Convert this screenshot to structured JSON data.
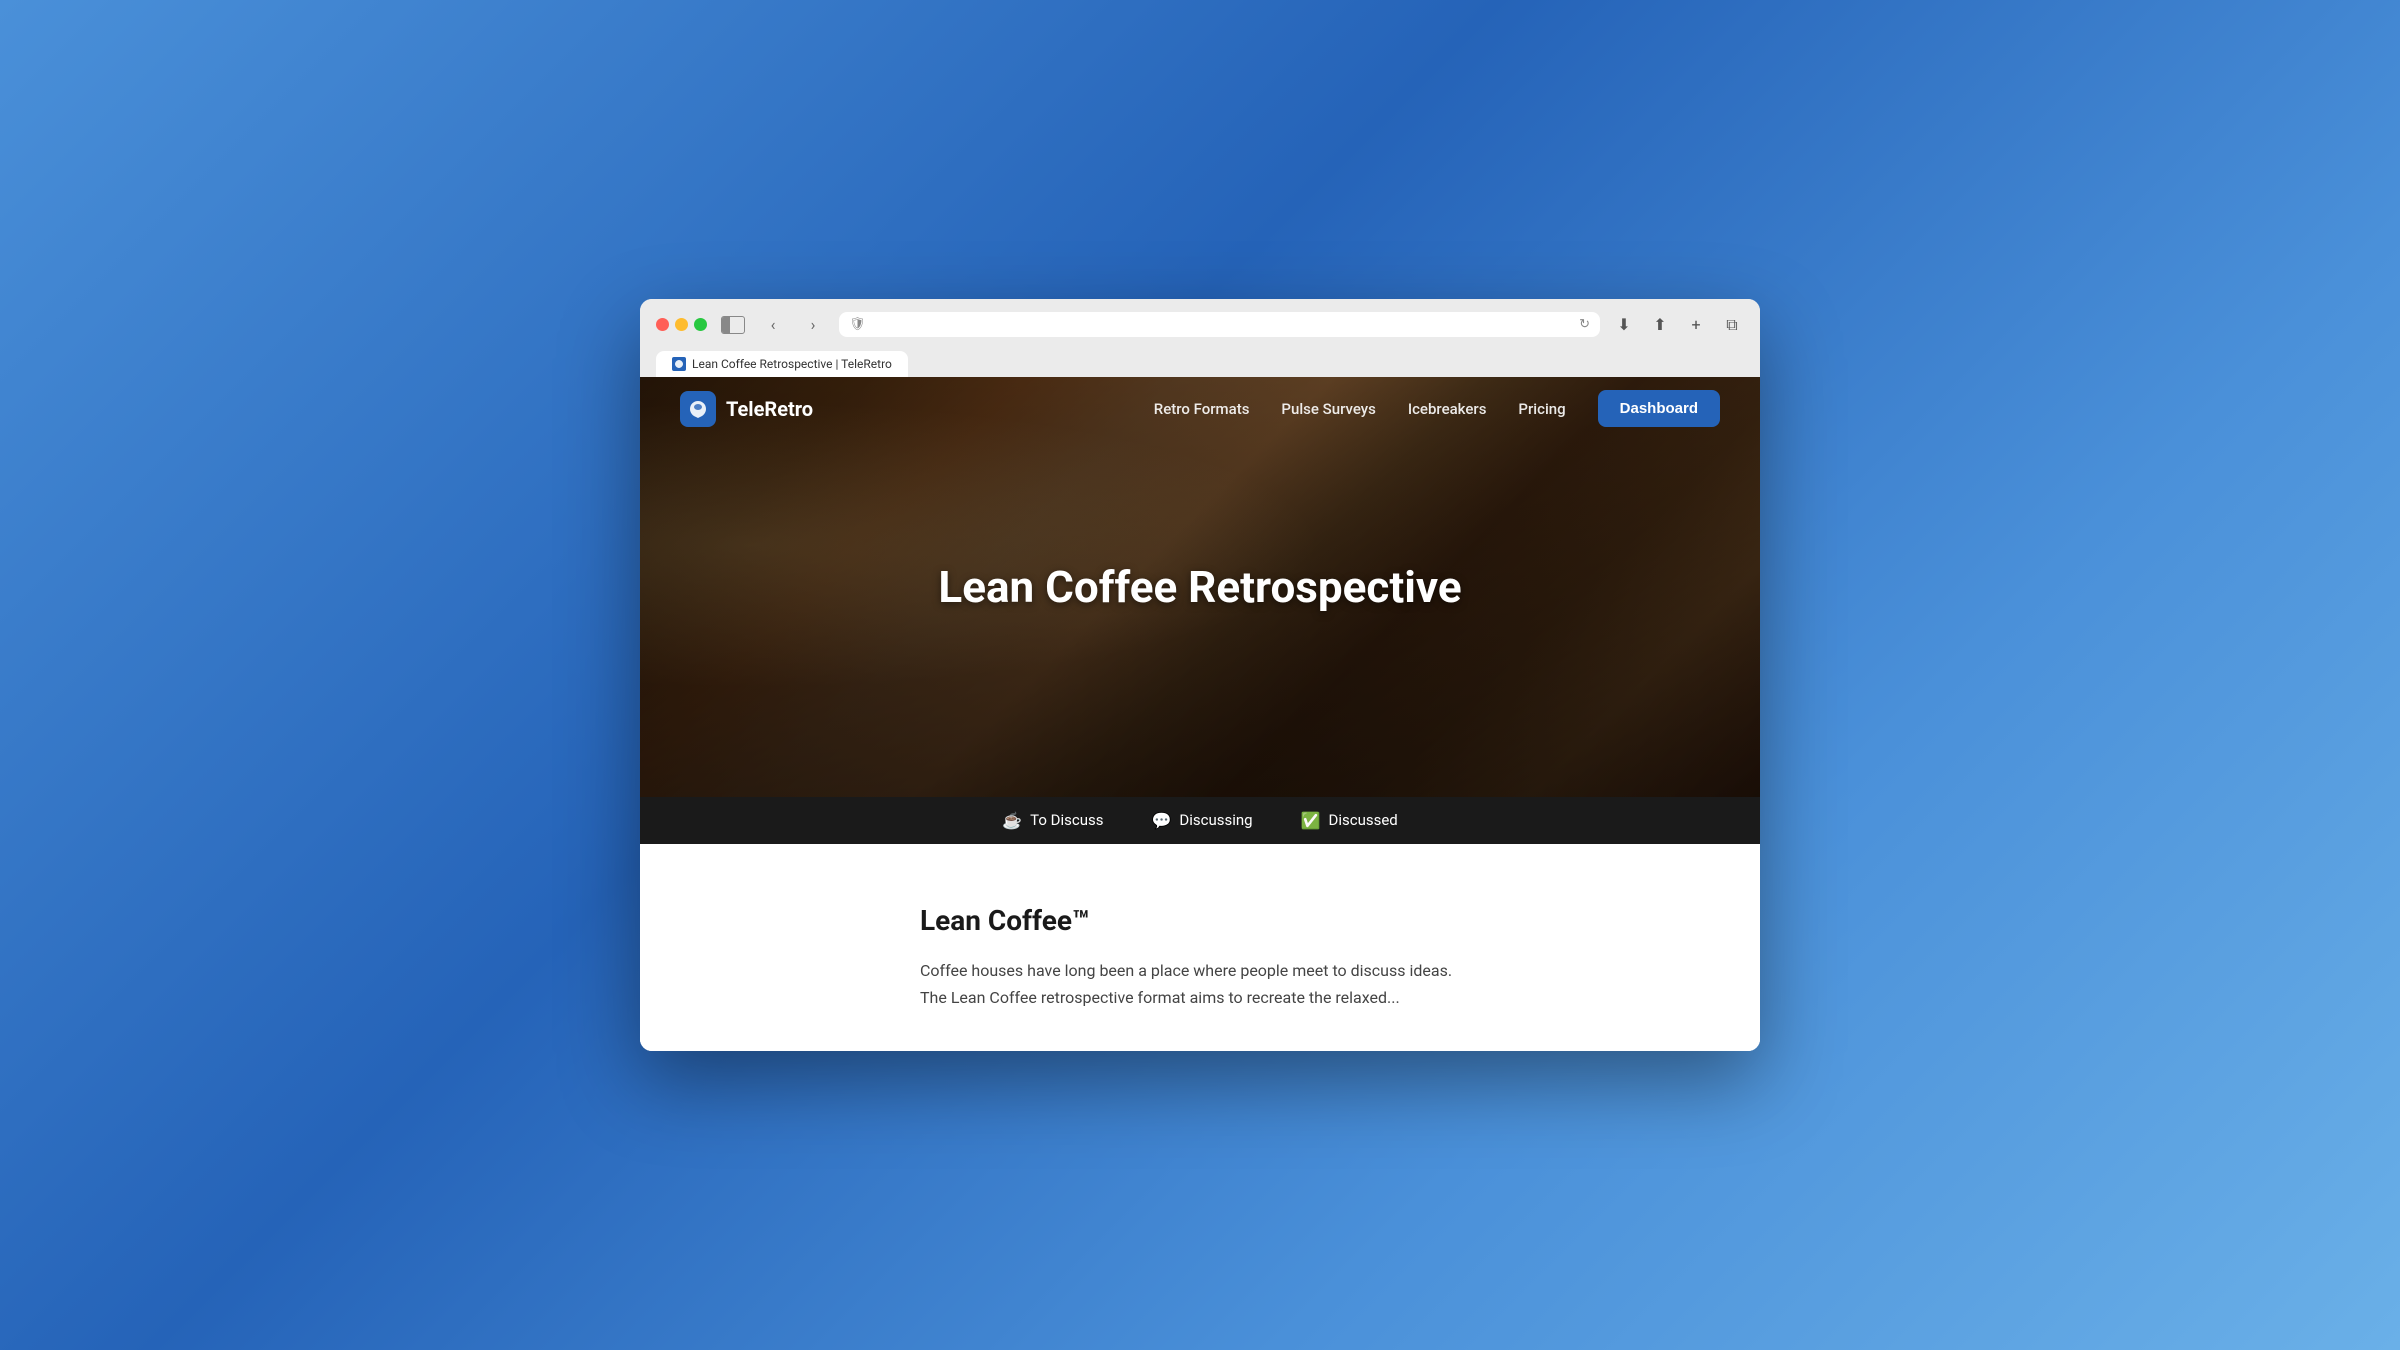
{
  "browser": {
    "address_bar_placeholder": "",
    "tab_label": "Lean Coffee Retrospective | TeleRetro"
  },
  "nav": {
    "logo_text": "TeleRetro",
    "links": [
      {
        "label": "Retro Formats",
        "id": "retro-formats"
      },
      {
        "label": "Pulse Surveys",
        "id": "pulse-surveys"
      },
      {
        "label": "Icebreakers",
        "id": "icebreakers"
      },
      {
        "label": "Pricing",
        "id": "pricing"
      }
    ],
    "dashboard_button": "Dashboard"
  },
  "hero": {
    "title": "Lean Coffee Retrospective"
  },
  "status_bar": {
    "items": [
      {
        "icon": "☕",
        "label": "To Discuss"
      },
      {
        "icon": "💬",
        "label": "Discussing"
      },
      {
        "icon": "✅",
        "label": "Discussed"
      }
    ]
  },
  "content": {
    "title": "Lean Coffee™",
    "text": "Coffee houses have long been a place where people meet to discuss ideas. The Lean Coffee retrospective format aims to recreate the relaxed..."
  },
  "colors": {
    "brand_blue": "#2563b8",
    "nav_bg": "transparent",
    "status_bar_bg": "#1a1a1a",
    "hero_overlay": "rgba(0,0,0,0.4)"
  }
}
